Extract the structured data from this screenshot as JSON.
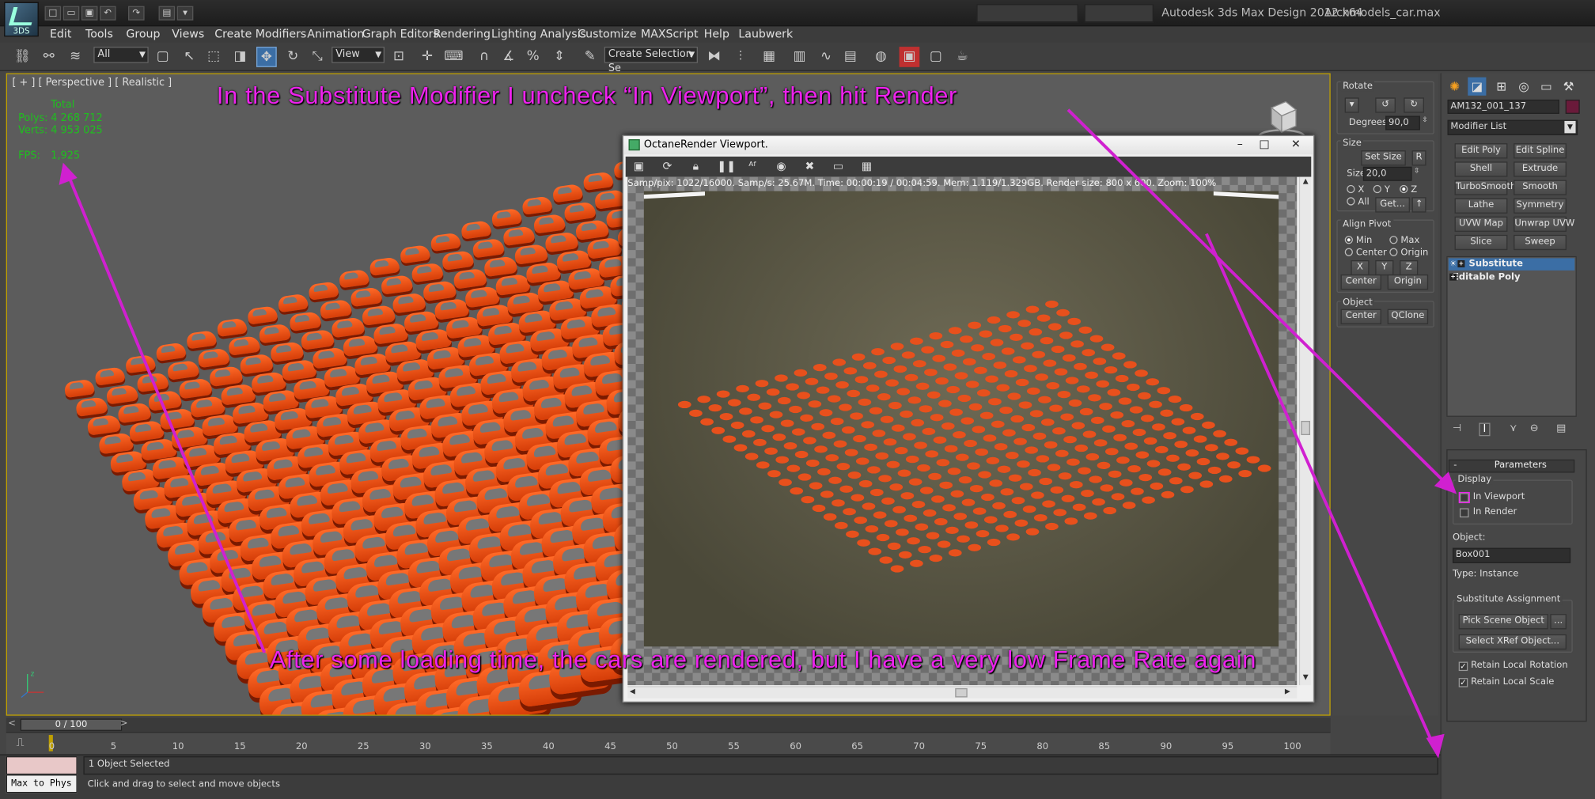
{
  "titlebar": {
    "app_title": "Autodesk 3ds Max Design 2012 x64",
    "file_name": "Archmodels_car.max",
    "logo_text": "3DS"
  },
  "menu": [
    "Edit",
    "Tools",
    "Group",
    "Views",
    "Create",
    "Modifiers",
    "Animation",
    "Graph Editors",
    "Rendering",
    "Lighting Analysis",
    "Customize",
    "MAXScript",
    "Help",
    "Laubwerk"
  ],
  "toolbar": {
    "selection_filter": "All",
    "reference_coord": "View",
    "named_selection": "Create Selection Se"
  },
  "viewport": {
    "label": "[ + ] [ Perspective ] [ Realistic ]",
    "stats_header": "Total",
    "polys_label": "Polys:",
    "polys_value": "4 268 712",
    "verts_label": "Verts:",
    "verts_value": "4 953 025",
    "fps_label": "FPS:",
    "fps_value": "1,925"
  },
  "octane": {
    "title": "OctaneRender Viewport.",
    "info": "Samp/pix: 1022/16000.   Samp/s: 25.67M.   Time: 00:00:19 / 00:04:59.   Mem: 1.119/1.329GB.   Render size: 800 x 600.   Zoom: 100%"
  },
  "mid_panel": {
    "rotate_title": "Rotate",
    "degrees_label": "Degrees:",
    "degrees_value": "90,0",
    "size_title": "Size",
    "set_size": "Set Size",
    "r_button": "R",
    "size_label": "Size",
    "size_value": "20,0",
    "axis_x": "X",
    "axis_y": "Y",
    "axis_z": "Z",
    "all_label": "All",
    "get_button": "Get...",
    "align_pivot_title": "Align Pivot",
    "min_label": "Min",
    "max_label": "Max",
    "center_label": "Center",
    "origin_label": "Origin",
    "btn_x": "X",
    "btn_y": "Y",
    "btn_z": "Z",
    "center_btn": "Center",
    "origin_btn": "Origin",
    "object_title": "Object",
    "obj_center_btn": "Center",
    "qclone_btn": "QClone"
  },
  "command_panel": {
    "object_name": "AM132_001_137",
    "modifier_list": "Modifier List",
    "mod_buttons": [
      "Edit Poly",
      "Edit Spline",
      "Shell",
      "Extrude",
      "TurboSmooth",
      "Smooth",
      "Lathe",
      "Symmetry",
      "UVW Map",
      "Unwrap UVW",
      "Slice",
      "Sweep"
    ],
    "stack": [
      "Substitute",
      "Editable Poly"
    ],
    "parameters_title": "Parameters",
    "collapse": "-",
    "display_title": "Display",
    "in_viewport": "In Viewport",
    "in_render": "In Render",
    "object_label": "Object:",
    "object_value": "Box001",
    "type_label": "Type: Instance",
    "assignment_title": "Substitute Assignment",
    "pick_scene": "Pick Scene Object",
    "ellipsis": "...",
    "select_xref": "Select XRef Object...",
    "retain_rotation": "Retain Local Rotation",
    "retain_scale": "Retain Local Scale"
  },
  "timeline": {
    "frame": "0 / 100",
    "ticks": [
      "0",
      "5",
      "10",
      "15",
      "20",
      "25",
      "30",
      "35",
      "40",
      "45",
      "50",
      "55",
      "60",
      "65",
      "70",
      "75",
      "80",
      "85",
      "90",
      "95",
      "100"
    ]
  },
  "status": {
    "selected": "1 Object Selected",
    "prompt": "Click and drag to select and move objects",
    "maxscript": "Max to Phys"
  },
  "annotations": {
    "top": "In the Substitute Modifier I uncheck “In Viewport”, then hit Render",
    "bottom": "After some loading time, the cars are rendered, but I have a very low Frame Rate again"
  },
  "colors": {
    "annotation": "#ee22ee",
    "car": "#e8501c",
    "stats_green": "#1fbf1f",
    "selection_highlight": "#3b6ea5"
  }
}
